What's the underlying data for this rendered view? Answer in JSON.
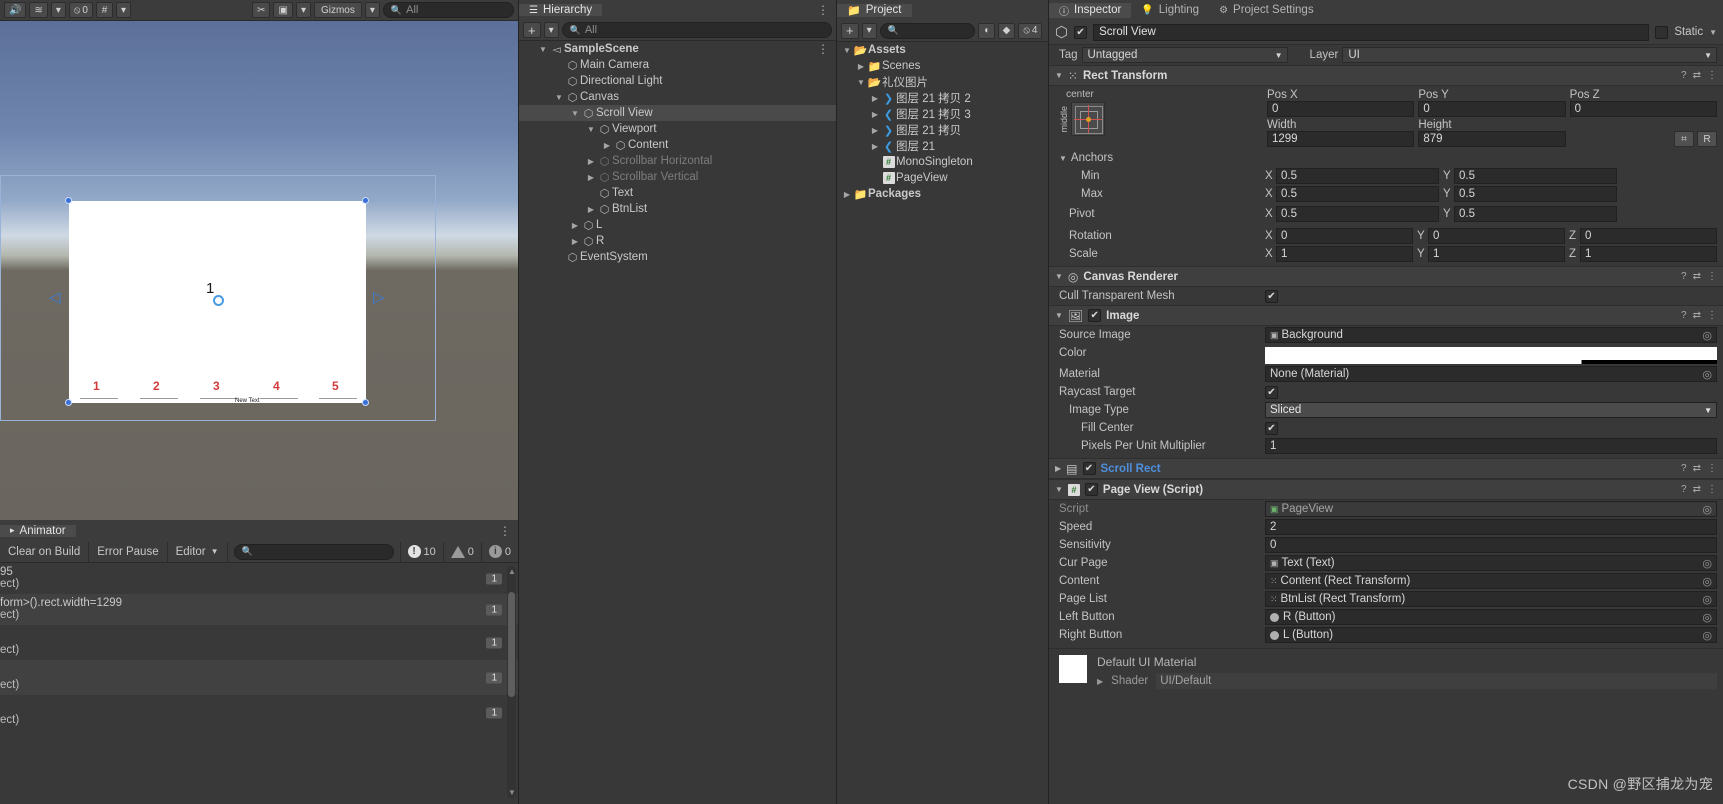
{
  "scene_view": {
    "toolbar": {
      "audio_icon": "audio-toggle",
      "layers_icon": "effects-toggle",
      "hidden_count": "0",
      "grid_icon": "grid-toggle",
      "tools_icon": "tools",
      "camera_icon": "camera",
      "gizmos_label": "Gizmos",
      "search_placeholder": "All"
    },
    "page_number": "1",
    "buttons": [
      "1",
      "2",
      "3",
      "4",
      "5"
    ],
    "new_text_label": "New Text"
  },
  "console": {
    "tab_label": "Animator",
    "buttons": {
      "clear_on_build": "Clear on Build",
      "error_pause": "Error Pause",
      "editor": "Editor"
    },
    "search_placeholder": "",
    "counts": {
      "errors": "10",
      "warnings": "0",
      "infos": "0"
    },
    "rows": [
      {
        "line1": "95",
        "line2": "ect)",
        "count": "1"
      },
      {
        "line1": "form>().rect.width=1299",
        "line2": "ect)",
        "count": "1"
      },
      {
        "line1": "",
        "line2": "ect)",
        "count": "1"
      },
      {
        "line1": "",
        "line2": "ect)",
        "count": "1"
      },
      {
        "line1": "",
        "line2": "ect)",
        "count": "1"
      }
    ]
  },
  "hierarchy": {
    "tab_label": "Hierarchy",
    "search_placeholder": "All",
    "items": [
      {
        "label": "SampleScene",
        "depth": 0,
        "twisty": "▼",
        "icon": "scene",
        "selected": false,
        "dim": false
      },
      {
        "label": "Main Camera",
        "depth": 1,
        "twisty": "",
        "icon": "cube",
        "selected": false,
        "dim": false
      },
      {
        "label": "Directional Light",
        "depth": 1,
        "twisty": "",
        "icon": "cube",
        "selected": false,
        "dim": false
      },
      {
        "label": "Canvas",
        "depth": 1,
        "twisty": "▼",
        "icon": "cube",
        "selected": false,
        "dim": false
      },
      {
        "label": "Scroll View",
        "depth": 2,
        "twisty": "▼",
        "icon": "cube",
        "selected": true,
        "dim": false
      },
      {
        "label": "Viewport",
        "depth": 3,
        "twisty": "▼",
        "icon": "cube",
        "selected": false,
        "dim": false
      },
      {
        "label": "Content",
        "depth": 4,
        "twisty": "▶",
        "icon": "cube",
        "selected": false,
        "dim": false
      },
      {
        "label": "Scrollbar Horizontal",
        "depth": 3,
        "twisty": "▶",
        "icon": "cube",
        "selected": false,
        "dim": true
      },
      {
        "label": "Scrollbar Vertical",
        "depth": 3,
        "twisty": "▶",
        "icon": "cube",
        "selected": false,
        "dim": true
      },
      {
        "label": "Text",
        "depth": 3,
        "twisty": "",
        "icon": "cube",
        "selected": false,
        "dim": false
      },
      {
        "label": "BtnList",
        "depth": 3,
        "twisty": "▶",
        "icon": "cube",
        "selected": false,
        "dim": false
      },
      {
        "label": "L",
        "depth": 2,
        "twisty": "▶",
        "icon": "cube",
        "selected": false,
        "dim": false
      },
      {
        "label": "R",
        "depth": 2,
        "twisty": "▶",
        "icon": "cube",
        "selected": false,
        "dim": false
      },
      {
        "label": "EventSystem",
        "depth": 1,
        "twisty": "",
        "icon": "cube",
        "selected": false,
        "dim": false
      }
    ]
  },
  "project": {
    "tab_label": "Project",
    "search_placeholder": "",
    "hidden_count": "4",
    "items": [
      {
        "label": "Assets",
        "depth": 0,
        "twisty": "▼",
        "icon": "folder-open",
        "bold": true
      },
      {
        "label": "Scenes",
        "depth": 1,
        "twisty": "▶",
        "icon": "folder",
        "bold": false
      },
      {
        "label": "礼仪图片",
        "depth": 1,
        "twisty": "▼",
        "icon": "folder-open",
        "bold": false
      },
      {
        "label": "图层 21 拷贝 2",
        "depth": 2,
        "twisty": "▶",
        "icon": "sprite-right",
        "bold": false
      },
      {
        "label": "图层 21 拷贝 3",
        "depth": 2,
        "twisty": "▶",
        "icon": "sprite-left",
        "bold": false
      },
      {
        "label": "图层 21 拷贝",
        "depth": 2,
        "twisty": "▶",
        "icon": "sprite-right",
        "bold": false
      },
      {
        "label": "图层 21",
        "depth": 2,
        "twisty": "▶",
        "icon": "sprite-left",
        "bold": false
      },
      {
        "label": "MonoSingleton",
        "depth": 2,
        "twisty": "",
        "icon": "csharp",
        "bold": false
      },
      {
        "label": "PageView",
        "depth": 2,
        "twisty": "",
        "icon": "csharp",
        "bold": false
      },
      {
        "label": "Packages",
        "depth": 0,
        "twisty": "▶",
        "icon": "folder",
        "bold": true
      }
    ]
  },
  "inspector": {
    "tabs": [
      {
        "label": "Inspector",
        "icon": "info-icon",
        "active": true
      },
      {
        "label": "Lighting",
        "icon": "bulb-icon",
        "active": false
      },
      {
        "label": "Project Settings",
        "icon": "gear-icon",
        "active": false
      }
    ],
    "object_name": "Scroll View",
    "object_enabled": true,
    "static_label": "Static",
    "tag_label": "Tag",
    "tag_value": "Untagged",
    "layer_label": "Layer",
    "layer_value": "UI",
    "rect_transform": {
      "title": "Rect Transform",
      "anchor_preset_h": "center",
      "anchor_preset_v": "middle",
      "pos_x_label": "Pos X",
      "pos_x": "0",
      "pos_y_label": "Pos Y",
      "pos_y": "0",
      "pos_z_label": "Pos Z",
      "pos_z": "0",
      "width_label": "Width",
      "width": "1299",
      "height_label": "Height",
      "height": "879",
      "blueprint_label": "R",
      "anchors_label": "Anchors",
      "min_label": "Min",
      "min_x": "0.5",
      "min_y": "0.5",
      "max_label": "Max",
      "max_x": "0.5",
      "max_y": "0.5",
      "pivot_label": "Pivot",
      "pivot_x": "0.5",
      "pivot_y": "0.5",
      "rotation_label": "Rotation",
      "rot_x": "0",
      "rot_y": "0",
      "rot_z": "0",
      "scale_label": "Scale",
      "scale_x": "1",
      "scale_y": "1",
      "scale_z": "1"
    },
    "canvas_renderer": {
      "title": "Canvas Renderer",
      "cull_label": "Cull Transparent Mesh",
      "cull_checked": true
    },
    "image": {
      "title": "Image",
      "enabled": true,
      "source_image_label": "Source Image",
      "source_image_value": "Background",
      "color_label": "Color",
      "material_label": "Material",
      "material_value": "None (Material)",
      "raycast_label": "Raycast Target",
      "raycast_checked": true,
      "image_type_label": "Image Type",
      "image_type_value": "Sliced",
      "fill_center_label": "Fill Center",
      "fill_center_checked": true,
      "ppu_label": "Pixels Per Unit Multiplier",
      "ppu_value": "1"
    },
    "scroll_rect": {
      "title": "Scroll Rect",
      "enabled": true
    },
    "page_view": {
      "title": "Page View (Script)",
      "enabled": true,
      "script_label": "Script",
      "script_value": "PageView",
      "speed_label": "Speed",
      "speed_value": "2",
      "sensitivity_label": "Sensitivity",
      "sensitivity_value": "0",
      "cur_page_label": "Cur Page",
      "cur_page_value": "Text (Text)",
      "content_label": "Content",
      "content_value": "Content (Rect Transform)",
      "page_list_label": "Page List",
      "page_list_value": "BtnList (Rect Transform)",
      "left_button_label": "Left Button",
      "left_button_value": "R (Button)",
      "right_button_label": "Right Button",
      "right_button_value": "L (Button)"
    },
    "material": {
      "name": "Default UI Material",
      "shader_label": "Shader",
      "shader_value": "UI/Default"
    }
  },
  "watermark": "CSDN @野区捕龙为宠"
}
